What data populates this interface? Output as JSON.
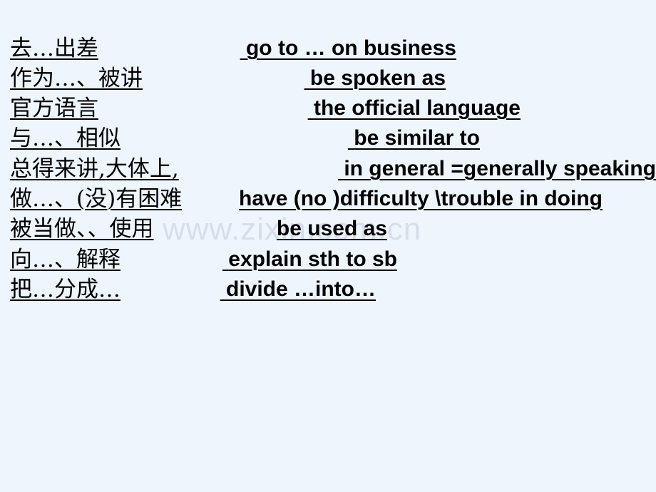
{
  "slide": {
    "background_color": "#eef5fd",
    "text_color": "#000000",
    "watermark": {
      "text": "www.zixin.com.cn",
      "color": "#d7dee9"
    }
  },
  "vocabulary_rows": [
    {
      "chinese": "去…出差",
      "english": "go to … on business"
    },
    {
      "chinese": "作为…、被讲",
      "english": "be spoken as"
    },
    {
      "chinese": "官方语言",
      "english": "the official language"
    },
    {
      "chinese": "与…、相似",
      "english": "be similar to"
    },
    {
      "chinese": "总得来讲,大体上,",
      "english": "in general  =generally speaking"
    },
    {
      "chinese": "做…、(没)有困难",
      "english": "have (no )difficulty \\trouble in doing"
    },
    {
      "chinese": "被当做、、使用",
      "english": "be used as"
    },
    {
      "chinese": "向…、解释",
      "english": "explain sth to sb"
    },
    {
      "chinese": "把…分成…",
      "english": "divide …into…"
    }
  ]
}
